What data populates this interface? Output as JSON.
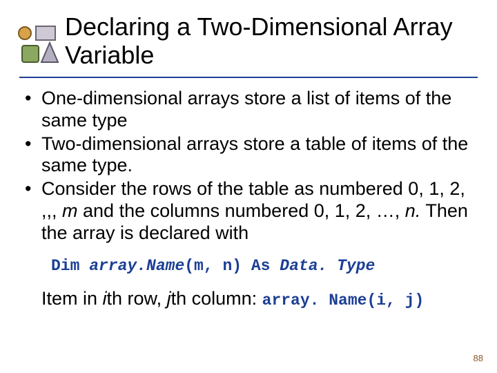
{
  "title": "Declaring a Two-Dimensional Array Variable",
  "bullets": [
    {
      "pre": "One-dimensional arrays store a list of items of the same type",
      "em": "",
      "post": ""
    },
    {
      "pre": "Two-dimensional arrays store a table of items of the same type.",
      "em": "",
      "post": ""
    },
    {
      "pre": "Consider the rows of the table as numbered 0, 1, 2, ,,, ",
      "em": "m",
      "mid": " and the columns numbered 0, 1, 2, …, ",
      "em2": "n.",
      "post": " Then the array is declared with"
    }
  ],
  "code": {
    "kw1": "Dim ",
    "name": "array.Name",
    "args": "(m, n) ",
    "kw2": "As ",
    "type": "Data. Type"
  },
  "item_line": {
    "t1": "Item in ",
    "i": "i",
    "t2": "th row, ",
    "j": "j",
    "t3": "th column: ",
    "code": "array. Name(i, j)"
  },
  "page_number": "88"
}
